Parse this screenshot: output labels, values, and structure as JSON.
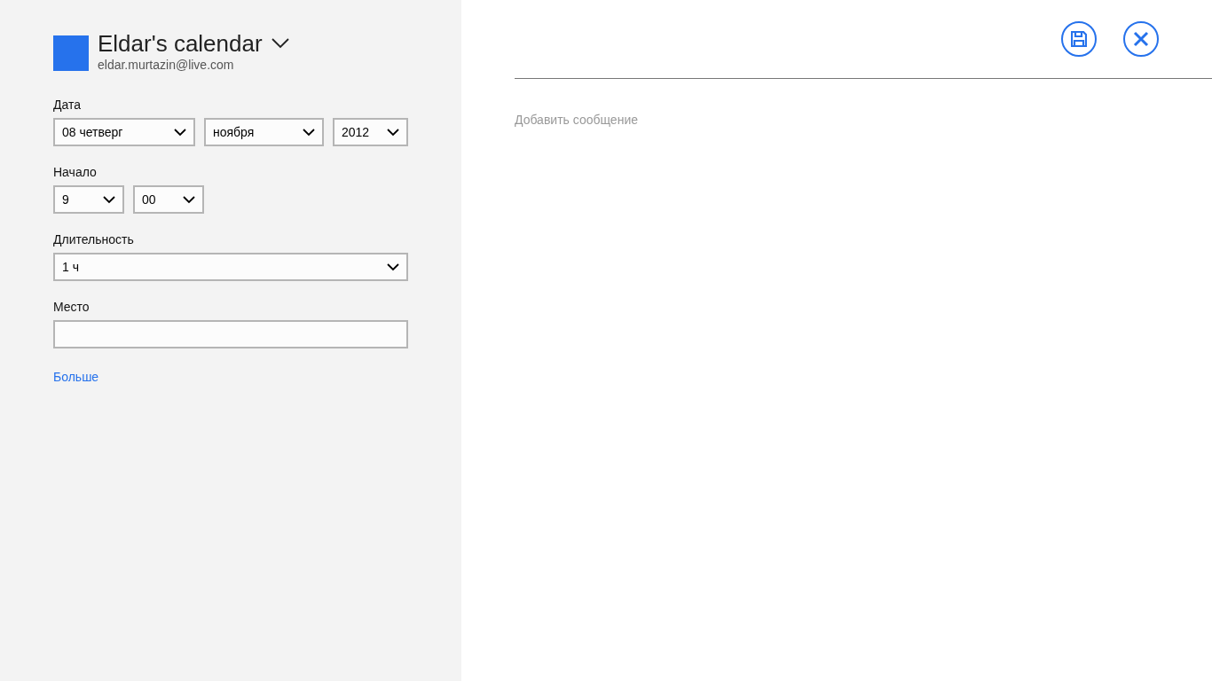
{
  "calendar": {
    "name": "Eldar's calendar",
    "email": "eldar.murtazin@live.com",
    "color": "#2672ec"
  },
  "fields": [
    {
      "label": "Дата",
      "kind": "selects",
      "selects": [
        {
          "value": "08 четверг"
        },
        {
          "value": "ноября"
        },
        {
          "value": "2012"
        }
      ]
    },
    {
      "label": "Начало",
      "kind": "selects",
      "selects": [
        {
          "value": "9"
        },
        {
          "value": "00"
        }
      ]
    },
    {
      "label": "Длительность",
      "kind": "selects",
      "selects": [
        {
          "value": "1 ч"
        }
      ]
    },
    {
      "label": "Место",
      "kind": "input"
    }
  ],
  "more_link": "Больше",
  "message": {
    "placeholder": "Добавить сообщение"
  }
}
